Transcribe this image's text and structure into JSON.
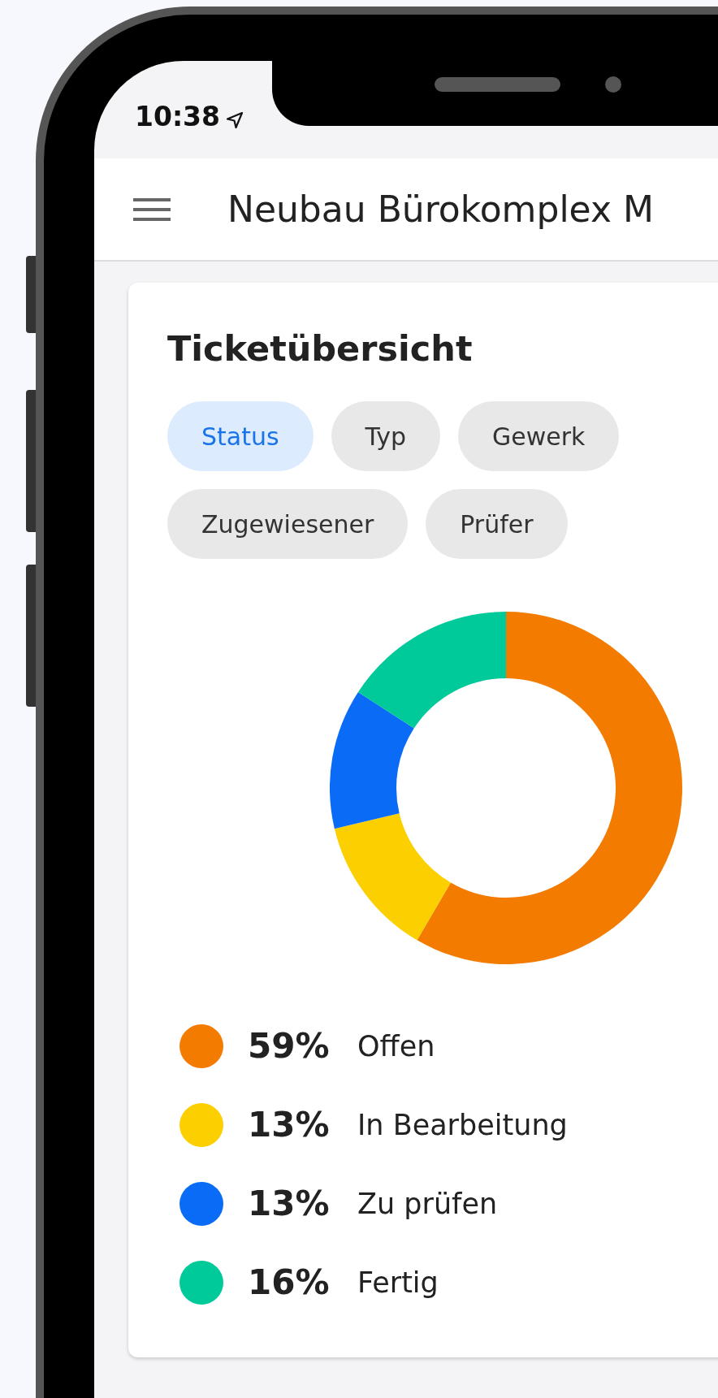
{
  "status_bar": {
    "time": "10:38"
  },
  "app_bar": {
    "title": "Neubau Bürokomplex M"
  },
  "card": {
    "title": "Ticketübersicht",
    "chips": [
      {
        "label": "Status",
        "selected": true
      },
      {
        "label": "Typ",
        "selected": false
      },
      {
        "label": "Gewerk",
        "selected": false
      },
      {
        "label": "Zugewiesener",
        "selected": false
      },
      {
        "label": "Prüfer",
        "selected": false
      }
    ],
    "chart_data": {
      "type": "donut",
      "values": [
        59,
        13,
        13,
        16
      ]
    },
    "legend": [
      {
        "percent": "59%",
        "label": "Offen",
        "color": "#f27b00"
      },
      {
        "percent": "13%",
        "label": "In Bearbeitung",
        "color": "#fcd000"
      },
      {
        "percent": "13%",
        "label": "Zu prüfen",
        "color": "#0a6cf6"
      },
      {
        "percent": "16%",
        "label": "Fertig",
        "color": "#00c99a"
      }
    ]
  }
}
